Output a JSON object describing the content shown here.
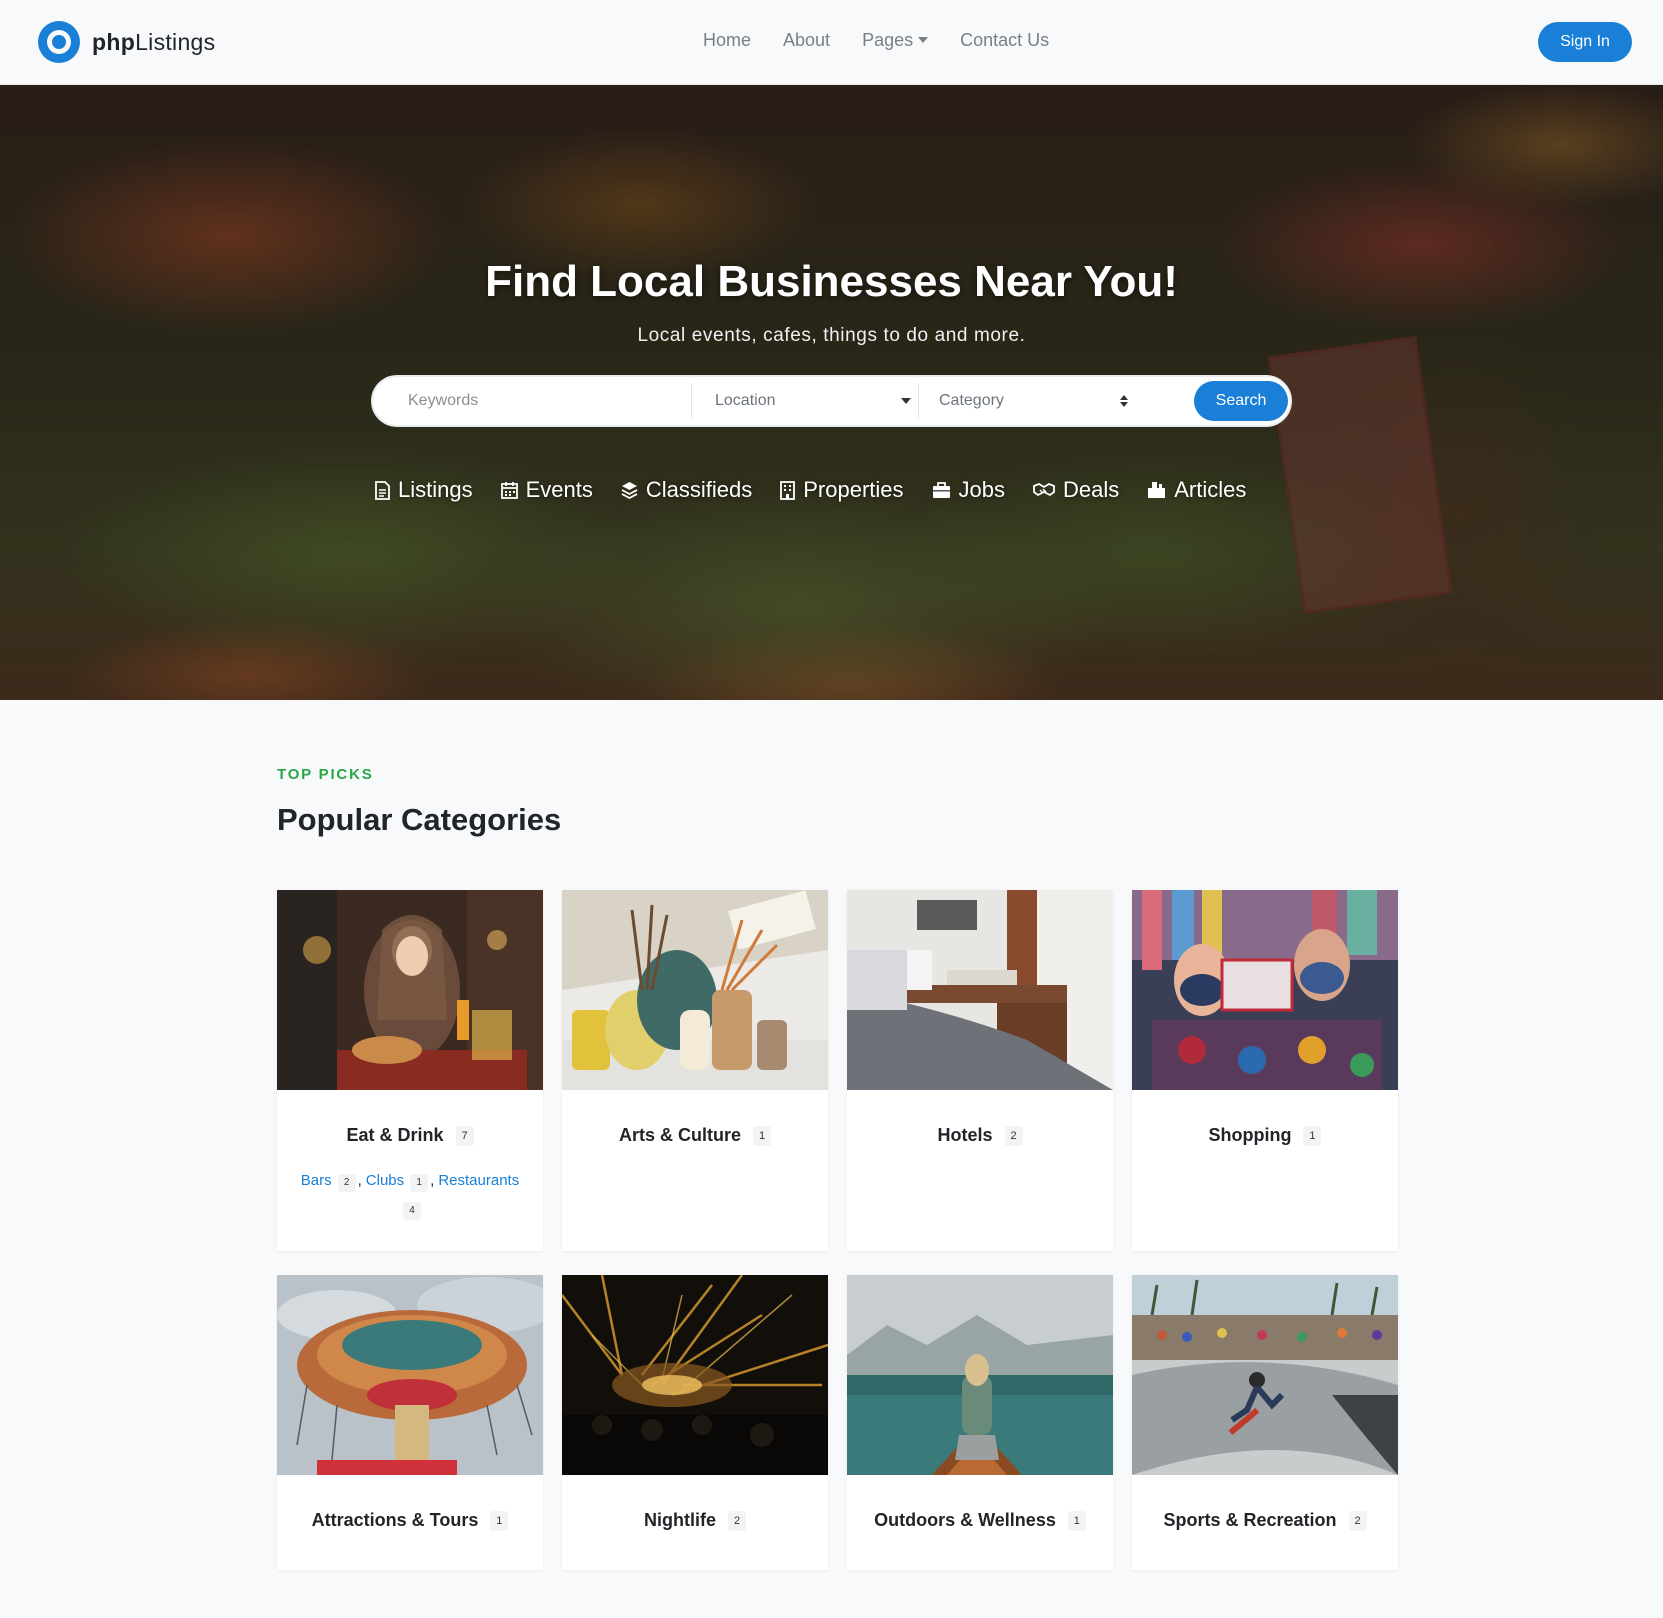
{
  "brand": {
    "bold": "php",
    "regular": "Listings"
  },
  "nav": {
    "links": [
      "Home",
      "About",
      "Pages",
      "Contact Us"
    ],
    "signin": "Sign In"
  },
  "hero": {
    "title": "Find Local Businesses Near You!",
    "subtitle": "Local events, cafes, things to do and more.",
    "search": {
      "keywords_placeholder": "Keywords",
      "location": "Location",
      "category": "Category",
      "button": "Search"
    },
    "tabs": [
      {
        "label": "Listings",
        "icon": "file-icon"
      },
      {
        "label": "Events",
        "icon": "calendar-icon"
      },
      {
        "label": "Classifieds",
        "icon": "layers-icon"
      },
      {
        "label": "Properties",
        "icon": "building-icon"
      },
      {
        "label": "Jobs",
        "icon": "briefcase-icon"
      },
      {
        "label": "Deals",
        "icon": "handshake-icon"
      },
      {
        "label": "Articles",
        "icon": "newspaper-icon"
      }
    ]
  },
  "categories": {
    "eyebrow": "TOP PICKS",
    "title": "Popular Categories",
    "items": [
      {
        "name": "Eat & Drink",
        "count": "7",
        "subcategories": [
          {
            "name": "Bars",
            "count": "2"
          },
          {
            "name": "Clubs",
            "count": "1"
          },
          {
            "name": "Restaurants",
            "count": "4"
          }
        ]
      },
      {
        "name": "Arts & Culture",
        "count": "1"
      },
      {
        "name": "Hotels",
        "count": "2"
      },
      {
        "name": "Shopping",
        "count": "1"
      },
      {
        "name": "Attractions & Tours",
        "count": "1"
      },
      {
        "name": "Nightlife",
        "count": "2"
      },
      {
        "name": "Outdoors & Wellness",
        "count": "1"
      },
      {
        "name": "Sports & Recreation",
        "count": "2"
      }
    ]
  },
  "colors": {
    "primary": "#1a7fd6",
    "eyebrow": "#28a745",
    "background": "#f8f9fa"
  }
}
